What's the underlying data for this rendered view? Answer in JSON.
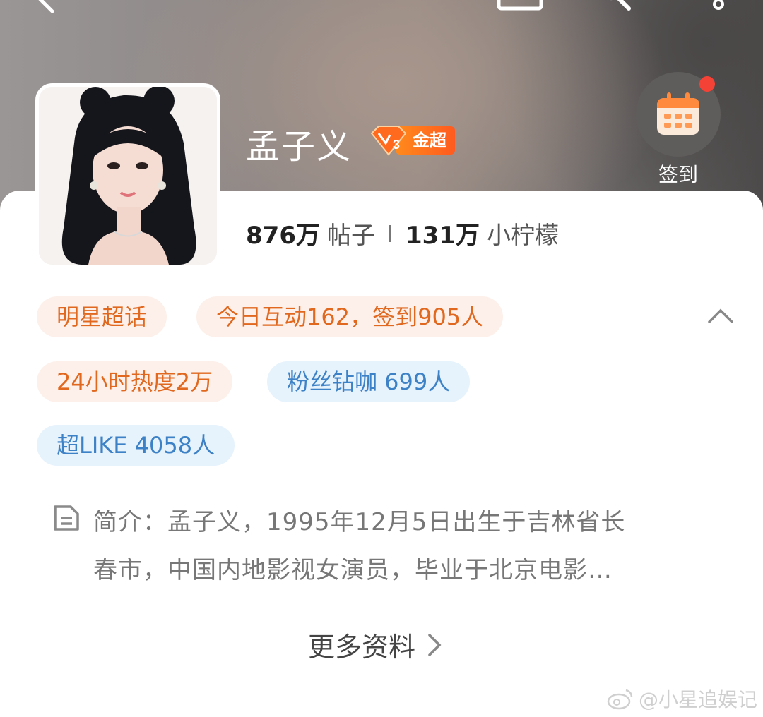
{
  "header": {
    "name": "孟子义",
    "badge_level": "3",
    "badge_label": "金超",
    "checkin_label": "签到"
  },
  "stats": {
    "posts_count": "876万",
    "posts_unit": "帖子",
    "fans_count": "131万",
    "fans_unit": "小柠檬"
  },
  "tags": [
    "明星超话",
    "今日互动162，签到905人",
    "24小时热度2万",
    "粉丝钻咖 699人",
    "超LIKE 4058人"
  ],
  "intro": {
    "label": "简介：",
    "line1": "孟子义，1995年12月5日出生于吉林省长",
    "line2": "春市，中国内地影视女演员，毕业于北京电影…"
  },
  "more_label": "更多资料",
  "watermark": "@小星追娱记",
  "colors": {
    "warm_tag_bg": "#fdf0ea",
    "warm_tag_text": "#e0681f",
    "cool_tag_bg": "#e6f2fc",
    "cool_tag_text": "#3d82c6",
    "badge": "#ff6a1f",
    "notification_dot": "#f44336"
  },
  "icons": [
    "back-icon",
    "share-icon",
    "search-icon",
    "more-icon",
    "calendar-icon",
    "chevron-up-icon",
    "document-icon",
    "chevron-right-icon",
    "weibo-icon"
  ]
}
